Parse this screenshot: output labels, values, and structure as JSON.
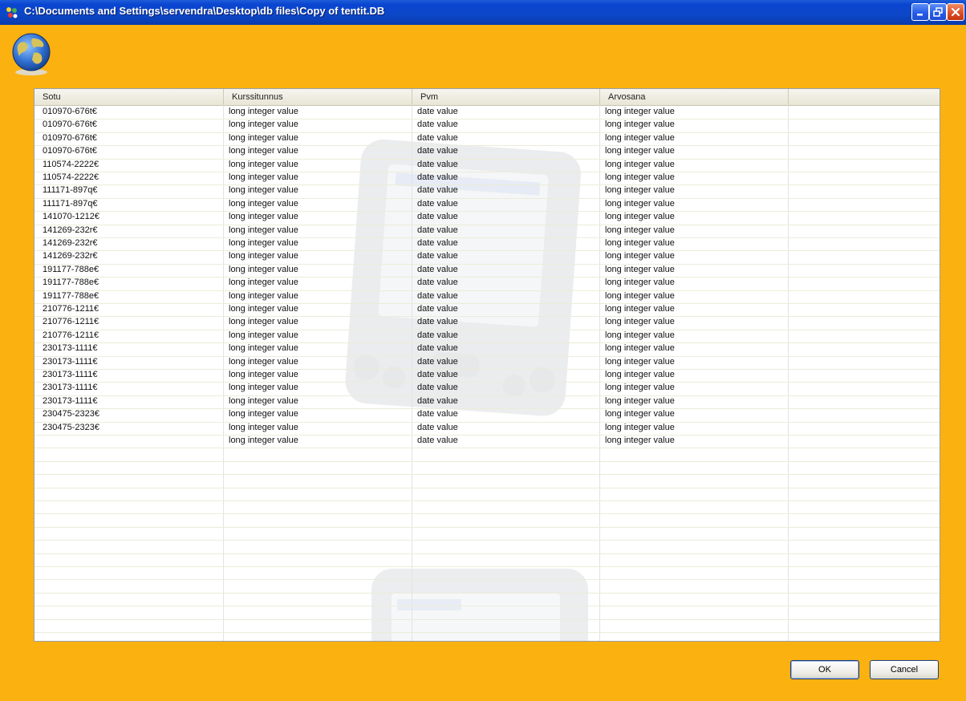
{
  "window": {
    "title": "C:\\Documents and Settings\\servendra\\Desktop\\db files\\Copy of tentit.DB"
  },
  "grid": {
    "columns": [
      "Sotu",
      "Kurssitunnus",
      "Pvm",
      "Arvosana"
    ],
    "rows": [
      [
        "010970-676t€",
        "long integer value",
        "date value",
        "long integer value"
      ],
      [
        "010970-676t€",
        "long integer value",
        "date value",
        "long integer value"
      ],
      [
        "010970-676t€",
        "long integer value",
        "date value",
        "long integer value"
      ],
      [
        "010970-676t€",
        "long integer value",
        "date value",
        "long integer value"
      ],
      [
        "110574-2222€",
        "long integer value",
        "date value",
        "long integer value"
      ],
      [
        "110574-2222€",
        "long integer value",
        "date value",
        "long integer value"
      ],
      [
        "111171-897q€",
        "long integer value",
        "date value",
        "long integer value"
      ],
      [
        "111171-897q€",
        "long integer value",
        "date value",
        "long integer value"
      ],
      [
        "141070-1212€",
        "long integer value",
        "date value",
        "long integer value"
      ],
      [
        "141269-232r€",
        "long integer value",
        "date value",
        "long integer value"
      ],
      [
        "141269-232r€",
        "long integer value",
        "date value",
        "long integer value"
      ],
      [
        "141269-232r€",
        "long integer value",
        "date value",
        "long integer value"
      ],
      [
        "191177-788e€",
        "long integer value",
        "date value",
        "long integer value"
      ],
      [
        "191177-788e€",
        "long integer value",
        "date value",
        "long integer value"
      ],
      [
        "191177-788e€",
        "long integer value",
        "date value",
        "long integer value"
      ],
      [
        "210776-1211€",
        "long integer value",
        "date value",
        "long integer value"
      ],
      [
        "210776-1211€",
        "long integer value",
        "date value",
        "long integer value"
      ],
      [
        "210776-1211€",
        "long integer value",
        "date value",
        "long integer value"
      ],
      [
        "230173-1111€",
        "long integer value",
        "date value",
        "long integer value"
      ],
      [
        "230173-1111€",
        "long integer value",
        "date value",
        "long integer value"
      ],
      [
        "230173-1111€",
        "long integer value",
        "date value",
        "long integer value"
      ],
      [
        "230173-1111€",
        "long integer value",
        "date value",
        "long integer value"
      ],
      [
        "230173-1111€",
        "long integer value",
        "date value",
        "long integer value"
      ],
      [
        "230475-2323€",
        "long integer value",
        "date value",
        "long integer value"
      ],
      [
        "230475-2323€",
        "long integer value",
        "date value",
        "long integer value"
      ],
      [
        "",
        "long integer value",
        "date value",
        "long integer value"
      ]
    ]
  },
  "buttons": {
    "ok": "OK",
    "cancel": "Cancel"
  },
  "icons": {
    "app": "app-icon",
    "globe": "globe-icon",
    "watermark": "pda-watermark"
  },
  "colors": {
    "window_background": "#fbb10f",
    "titlebar": "#0a45d1"
  }
}
